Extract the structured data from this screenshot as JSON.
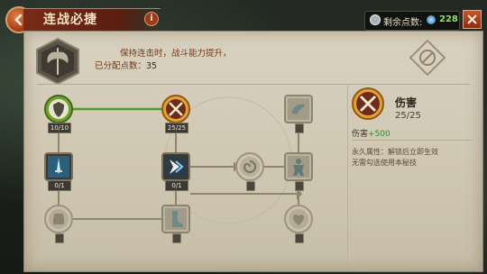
{
  "header": {
    "title": "连战必捷",
    "info_label": "i",
    "points_label": "剩余点数:",
    "points_value": "228"
  },
  "panel": {
    "description": "保持连击时，战斗能力提升，",
    "allocated_label": "已分配点数：",
    "allocated_value": "35"
  },
  "tree": {
    "nodes": [
      {
        "id": "shield",
        "count": "10/10",
        "unlocked": true,
        "icon": "shield-icon"
      },
      {
        "id": "crossed-swords",
        "count": "25/25",
        "unlocked": true,
        "icon": "crossed-swords-icon"
      },
      {
        "id": "sword-blue",
        "count": "0/1",
        "unlocked": true,
        "icon": "blue-sword-icon"
      },
      {
        "id": "dash-arrow",
        "count": "0/1",
        "unlocked": true,
        "icon": "dash-arrow-icon"
      },
      {
        "id": "fist",
        "count": "",
        "unlocked": false,
        "icon": "fist-icon"
      },
      {
        "id": "swirl",
        "count": "",
        "unlocked": false,
        "icon": "swirl-icon"
      },
      {
        "id": "boot",
        "count": "",
        "unlocked": false,
        "icon": "boot-icon"
      },
      {
        "id": "bird",
        "count": "",
        "unlocked": false,
        "icon": "bird-icon"
      },
      {
        "id": "fighter",
        "count": "",
        "unlocked": false,
        "icon": "fighter-icon"
      },
      {
        "id": "heart",
        "count": "",
        "unlocked": false,
        "icon": "heart-icon"
      }
    ]
  },
  "detail": {
    "name": "伤害",
    "level": "25/25",
    "stat_label": "伤害",
    "stat_value": "+500",
    "passive_line1": "永久属性：解锁后立即生效",
    "passive_line2": "无需勾选使用本秘技"
  },
  "colors": {
    "accent_orange": "#c4562c",
    "unlocked_green": "#4e9a2a",
    "points_green": "#8fe35a"
  }
}
